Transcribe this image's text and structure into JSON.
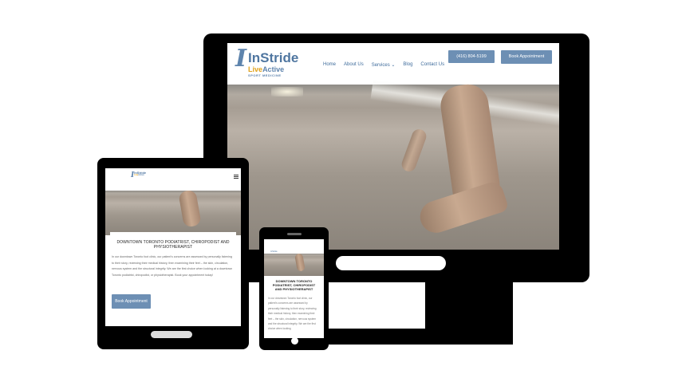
{
  "brand": {
    "mark": "I",
    "name": "InStride",
    "live_a": "Live",
    "live_b": "Active",
    "sub": "SPORT MEDICINE"
  },
  "nav": {
    "items": [
      "Home",
      "About Us",
      "Services ⌄",
      "Blog",
      "Contact Us"
    ]
  },
  "header": {
    "phone_label": "(416) 804-5199",
    "book_label": "Book Appointment"
  },
  "tablet": {
    "title": "DOWNTOWN TORONTO PODIATRIST, CHIROPODIST AND PHYSIOTHERAPIST",
    "body": "In our downtown Toronto foot clinic, our patient's concerns are assessed by personally listening to their story, reviewing their medical history, then examining their feet – the skin, circulation, nervous system and the structural integrity. We are the first choice when looking at a downtown Toronto podiatrist, chiropodist, or physiotherapist. Book your appointment today!",
    "button": "Book Appointment"
  },
  "phone": {
    "title": "DOWNTOWN TORONTO PODIATRIST, CHIROPODIST AND PHYSIOTHERAPIST",
    "body": "In our downtown Toronto foot clinic, our patient's concerns are assessed by personally listening to their story, reviewing their medical history, then examining their feet – the skin, circulation, nervous system and the structural integrity. We are the first choice when looking"
  },
  "colors": {
    "accent": "#6d8fb4",
    "nav_text": "#3f6c9c",
    "live_orange": "#e0a21a"
  },
  "icons": {
    "menu": "hamburger-icon"
  }
}
